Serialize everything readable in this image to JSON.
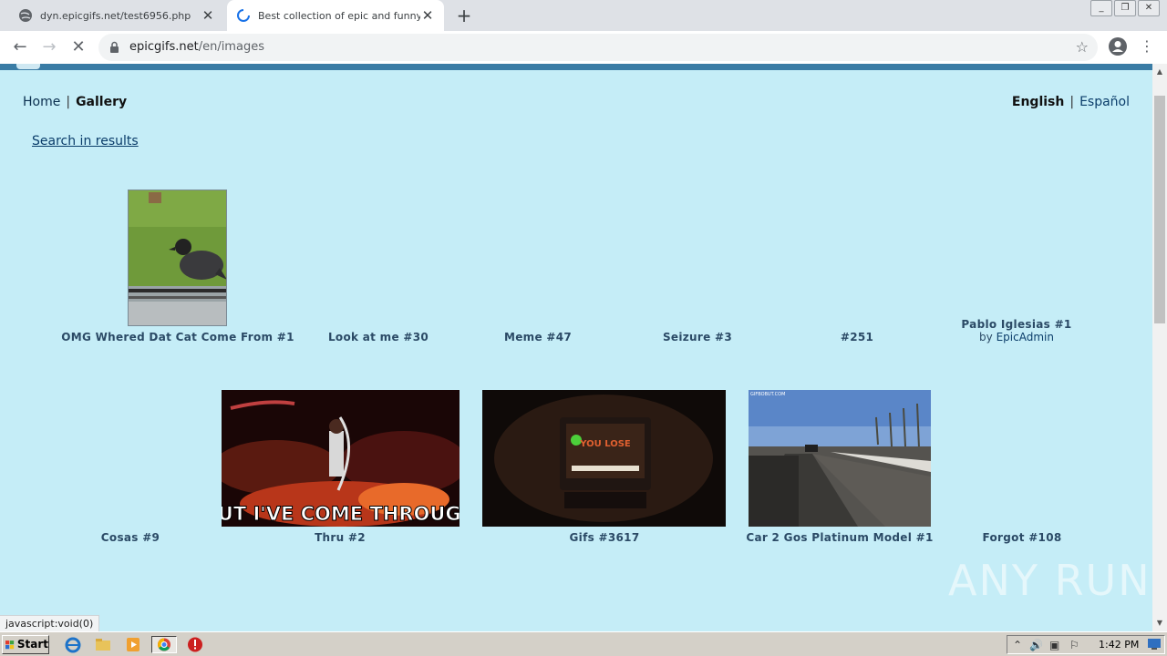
{
  "browser": {
    "tabs": [
      {
        "title": "dyn.epicgifs.net/test6956.php",
        "active": false
      },
      {
        "title": "Best collection of epic and funny gifs",
        "active": true
      }
    ],
    "url_host": "epicgifs.net",
    "url_path": "/en/images",
    "status_text": "javascript:void(0)"
  },
  "page": {
    "breadcrumb": {
      "home": "Home",
      "separator": "|",
      "current": "Gallery"
    },
    "language": {
      "current": "English",
      "separator": "|",
      "other": "Español"
    },
    "search_link": "Search in results",
    "row1": [
      {
        "title": "OMG Whered Dat Cat Come From #1",
        "thumb": "crow"
      },
      {
        "title": "Look at me #30"
      },
      {
        "title": "Meme #47"
      },
      {
        "title": "Seizure #3"
      },
      {
        "title": "#251"
      },
      {
        "title": "Pablo Iglesias #1",
        "byline_prefix": "by",
        "author": "EpicAdmin"
      }
    ],
    "row2": [
      {
        "title": "Cosas #9"
      },
      {
        "title": "Thru #2",
        "thumb": "concert",
        "caption": "BUT I'VE COME THROUGH"
      },
      {
        "title": "Gifs #3617",
        "thumb": "tv",
        "tv_text": "YOU LOSE"
      },
      {
        "title": "Car 2 Gos Platinum Model #1",
        "thumb": "road",
        "watermark": "GIFBOBUT.COM"
      },
      {
        "title": "Forgot #108"
      }
    ],
    "watermark": "ANY RUN"
  },
  "taskbar": {
    "start_label": "Start",
    "clock": "1:42 PM"
  },
  "colors": {
    "page_bg": "#c5edf7",
    "link": "#0b3d6a",
    "title_text": "#2b4a66",
    "top_band": "#3a7ca5"
  }
}
